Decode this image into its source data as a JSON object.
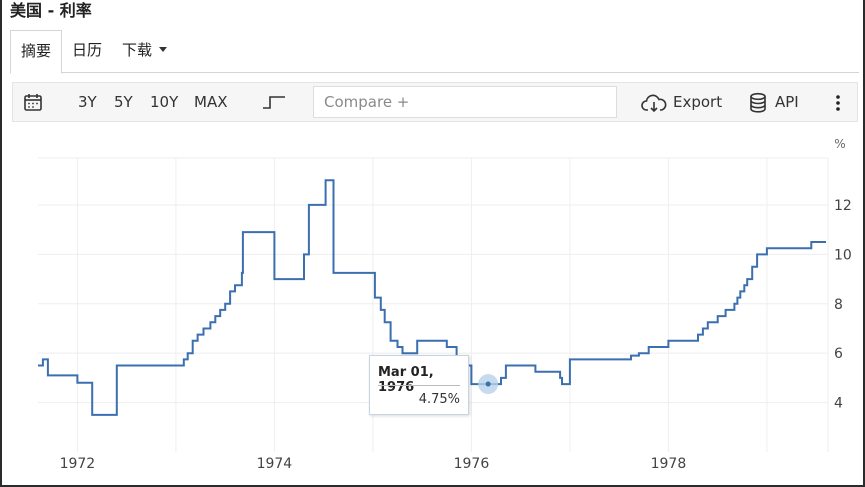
{
  "title": "美国 - 利率",
  "tabs": [
    {
      "label": "摘要",
      "active": true
    },
    {
      "label": "日历",
      "active": false
    },
    {
      "label": "下载",
      "active": false
    }
  ],
  "toolbar": {
    "ranges": [
      "3Y",
      "5Y",
      "10Y",
      "MAX"
    ],
    "compare_placeholder": "Compare +",
    "export_label": "Export",
    "api_label": "API",
    "icons": [
      "calendar-icon",
      "step-line-icon",
      "cloud-download-icon",
      "database-icon",
      "more-vert-icon"
    ]
  },
  "tooltip": {
    "date": "Mar 01, 1976",
    "value": "4.75%"
  },
  "colors": {
    "line": "#3a6fb0",
    "grid": "#eeeeee",
    "toolbar_bg": "#f6f6f6",
    "hover_marker": "#b9d2ea"
  },
  "chart_data": {
    "type": "line",
    "unit": "%",
    "x_tick_labels": [
      "1972",
      "1974",
      "1976",
      "1978"
    ],
    "y_tick_labels": [
      "4",
      "6",
      "8",
      "10",
      "12"
    ],
    "xlim": [
      1971.6,
      1979.62
    ],
    "ylim": [
      2.0,
      13.9
    ],
    "grid": true,
    "step": true,
    "series": [
      {
        "x": [
          1971.6,
          1971.65,
          1971.7,
          1972.0,
          1972.15,
          1972.4,
          1972.6,
          1973.0,
          1973.02,
          1973.08,
          1973.12,
          1973.17,
          1973.22,
          1973.28,
          1973.35,
          1973.4,
          1973.45,
          1973.5,
          1973.55,
          1973.6,
          1973.67,
          1973.68,
          1974.0,
          1974.15,
          1974.3,
          1974.35,
          1974.52,
          1974.6,
          1974.8,
          1975.0,
          1975.02,
          1975.08,
          1975.12,
          1975.18,
          1975.25,
          1975.3,
          1975.45,
          1975.6,
          1975.75,
          1975.85,
          1976.0,
          1976.17,
          1976.3,
          1976.35,
          1976.5,
          1976.65,
          1976.8,
          1976.9,
          1976.92,
          1977.0,
          1977.2,
          1977.5,
          1977.62,
          1977.7,
          1977.8,
          1978.0,
          1978.3,
          1978.3,
          1978.35,
          1978.4,
          1978.5,
          1978.58,
          1978.62,
          1978.67,
          1978.7,
          1978.73,
          1978.77,
          1978.8,
          1978.85,
          1978.9,
          1979.0,
          1979.3,
          1979.45,
          1979.6
        ],
        "y": [
          5.5,
          5.75,
          5.1,
          4.8,
          3.5,
          5.5,
          5.5,
          5.5,
          5.5,
          5.75,
          6.0,
          6.5,
          6.75,
          7.0,
          7.25,
          7.5,
          7.75,
          8.0,
          8.5,
          8.75,
          9.25,
          10.9,
          9.0,
          9.0,
          10.0,
          12.0,
          13.0,
          9.25,
          9.25,
          9.25,
          8.25,
          7.75,
          7.25,
          6.5,
          6.25,
          6.0,
          6.5,
          6.5,
          6.25,
          5.5,
          4.75,
          4.75,
          5.0,
          5.5,
          5.5,
          5.25,
          5.25,
          5.0,
          4.75,
          5.75,
          5.75,
          5.75,
          5.9,
          6.0,
          6.25,
          6.5,
          6.75,
          6.75,
          7.0,
          7.25,
          7.5,
          7.75,
          7.75,
          8.0,
          8.25,
          8.5,
          8.75,
          9.0,
          9.5,
          10.0,
          10.25,
          10.25,
          10.5,
          10.5
        ]
      }
    ]
  }
}
